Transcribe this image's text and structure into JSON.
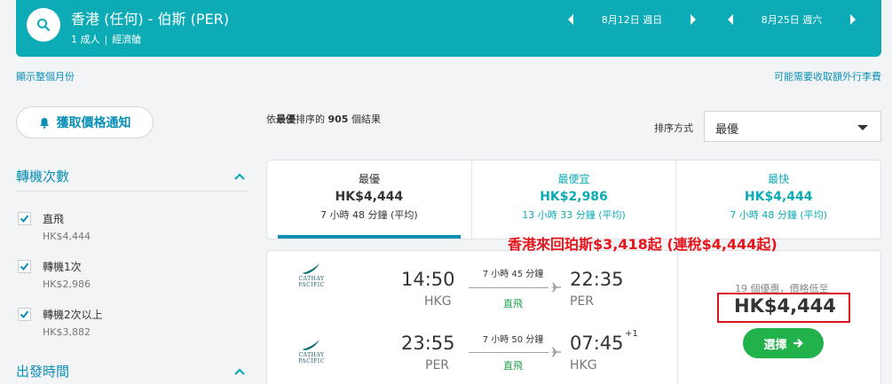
{
  "header": {
    "route": "香港 (任何) - 伯斯 (PER)",
    "passengers": "1 成人",
    "cabin": "經濟艙",
    "depart_date": "8月12日 週日",
    "return_date": "8月25日 週六",
    "accent": "#0cabb5"
  },
  "links": {
    "show_month": "顯示整個月份",
    "baggage_fee": "可能需要收取額外行李費"
  },
  "alert_button": {
    "label": "獲取價格通知",
    "icon": "bell-icon"
  },
  "filters": {
    "stops_title": "轉機次數",
    "stops": [
      {
        "label": "直飛",
        "price": "HK$4,444",
        "checked": true
      },
      {
        "label": "轉機1次",
        "price": "HK$2,986",
        "checked": true
      },
      {
        "label": "轉機2次以上",
        "price": "HK$3,882",
        "checked": true
      }
    ],
    "departure_title": "出發時間"
  },
  "results": {
    "summary_prefix": "依",
    "summary_bold": "最優",
    "summary_mid": "排序的",
    "summary_count": "905",
    "summary_suffix": "個結果",
    "sort_label": "排序方式",
    "sort_value": "最優"
  },
  "tabs": [
    {
      "title": "最優",
      "price": "HK$4,444",
      "duration": "7 小時 48 分鐘 (平均)",
      "active": true
    },
    {
      "title": "最便宜",
      "price": "HK$2,986",
      "duration": "13 小時 33 分鐘 (平均)",
      "active": false
    },
    {
      "title": "最快",
      "price": "HK$4,444",
      "duration": "7 小時 48 分鐘 (平均)",
      "active": false
    }
  ],
  "promo_text": "香港來回珀斯$3,418起 (連稅$4,444起)",
  "result_card": {
    "airline": "CATHAY PACIFIC",
    "outbound": {
      "depart_time": "14:50",
      "depart_code": "HKG",
      "arrive_time": "22:35",
      "arrive_code": "PER",
      "duration": "7 小時 45 分鐘",
      "stops": "直飛"
    },
    "inbound": {
      "depart_time": "23:55",
      "depart_code": "PER",
      "arrive_time": "07:45",
      "arrive_code": "HKG",
      "day_offset": "+1",
      "duration": "7 小時 50 分鐘",
      "stops": "直飛"
    },
    "deals": "19 個優惠，價格低至",
    "price": "HK$4,444",
    "select_label": "選擇"
  }
}
